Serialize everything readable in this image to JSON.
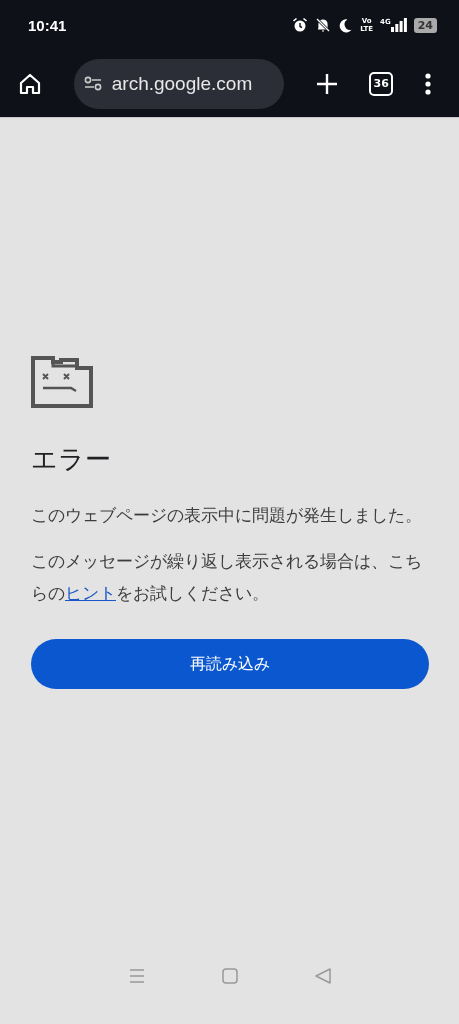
{
  "status_bar": {
    "time": "10:41",
    "network": "4G",
    "volte": "Vo LTE",
    "battery": "24"
  },
  "toolbar": {
    "url": "arch.google.com",
    "tab_count": "36"
  },
  "error": {
    "title": "エラー",
    "message": "このウェブページの表示中に問題が発生しました。",
    "hint": {
      "before": "このメッセージが繰り返し表示される場合は、こちらの",
      "link": "ヒント",
      "after": "をお試しください。"
    },
    "button": "再読み込み"
  }
}
